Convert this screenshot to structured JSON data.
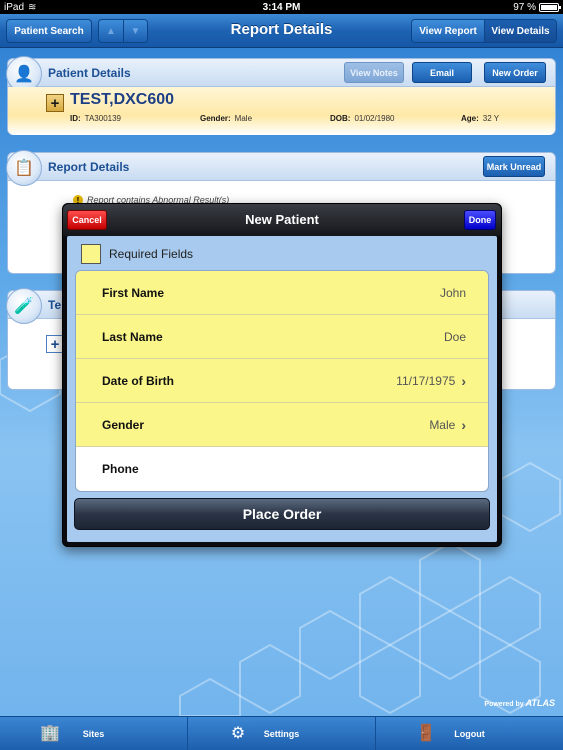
{
  "status_bar": {
    "carrier": "iPad",
    "time": "3:14 PM",
    "battery": "97 %"
  },
  "nav": {
    "patient_search": "Patient Search",
    "title": "Report Details",
    "view_report": "View Report",
    "view_details": "View Details"
  },
  "patient_panel": {
    "title": "Patient Details",
    "view_notes": "View Notes",
    "email": "Email",
    "new_order": "New Order",
    "name": "TEST,DXC600",
    "id_label": "ID:",
    "id_value": "TA300139",
    "gender_label": "Gender:",
    "gender_value": "Male",
    "dob_label": "DOB:",
    "dob_value": "01/02/1980",
    "age_label": "Age:",
    "age_value": "32 Y"
  },
  "report_panel": {
    "title": "Report Details",
    "mark_unread": "Mark Unread",
    "note": "Report contains Abnormal Result(s)"
  },
  "tests_panel": {
    "title_partial": "Te"
  },
  "modal": {
    "title": "New Patient",
    "cancel": "Cancel",
    "done": "Done",
    "required_fields": "Required Fields",
    "fields": [
      {
        "label": "First Name",
        "value": "John"
      },
      {
        "label": "Last Name",
        "value": "Doe"
      },
      {
        "label": "Date of Birth",
        "value": "11/17/1975"
      },
      {
        "label": "Gender",
        "value": "Male"
      },
      {
        "label": "Phone",
        "value": ""
      }
    ],
    "place_order": "Place Order"
  },
  "footer": {
    "powered_by": "Powered by",
    "brand": "ATLAS"
  },
  "tabs": {
    "sites": "Sites",
    "settings": "Settings",
    "logout": "Logout"
  },
  "colors": {
    "required_yellow": "#fbf68a",
    "cancel_red": "#e00000",
    "done_blue": "#1a1aff",
    "nav_blue": "#1e63b3"
  }
}
